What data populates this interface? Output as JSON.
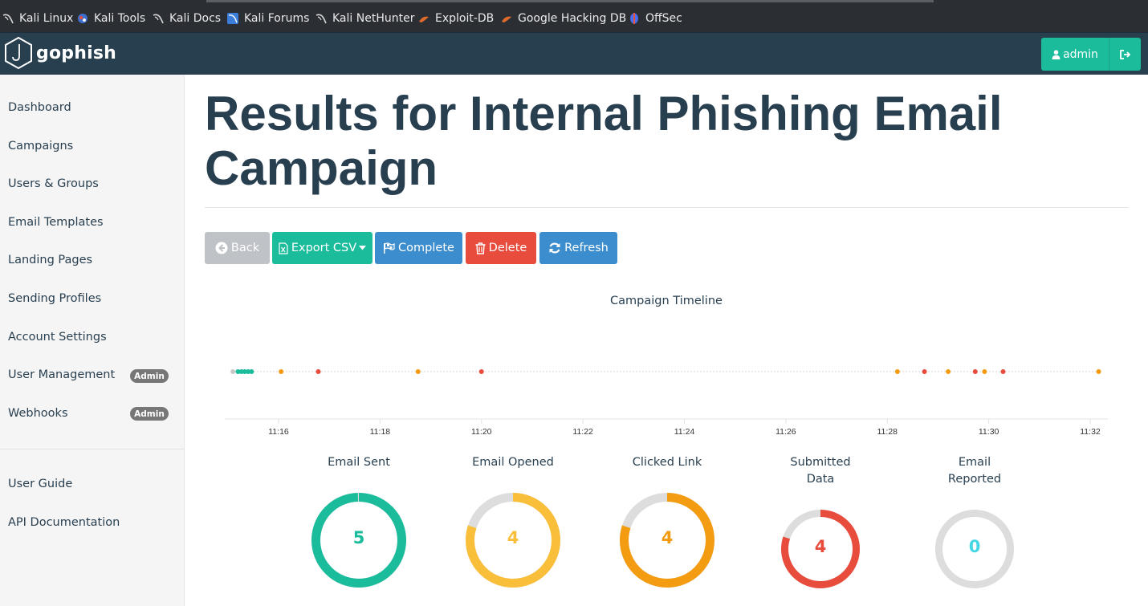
{
  "bookmarks": [
    {
      "label": "Kali Linux",
      "icon": "kali-dragon-icon"
    },
    {
      "label": "Kali Tools",
      "icon": "kali-tools-icon"
    },
    {
      "label": "Kali Docs",
      "icon": "kali-dragon-icon"
    },
    {
      "label": "Kali Forums",
      "icon": "kali-forums-icon"
    },
    {
      "label": "Kali NetHunter",
      "icon": "kali-dragon-icon"
    },
    {
      "label": "Exploit-DB",
      "icon": "exploit-db-icon"
    },
    {
      "label": "Google Hacking DB",
      "icon": "exploit-db-icon"
    },
    {
      "label": "OffSec",
      "icon": "offsec-icon"
    }
  ],
  "navbar": {
    "brand": "gophish",
    "user_label": "admin",
    "colors": {
      "bar": "#283f50",
      "accent": "#1abc9c"
    }
  },
  "sidebar": {
    "items": [
      {
        "label": "Dashboard"
      },
      {
        "label": "Campaigns"
      },
      {
        "label": "Users & Groups"
      },
      {
        "label": "Email Templates"
      },
      {
        "label": "Landing Pages"
      },
      {
        "label": "Sending Profiles"
      },
      {
        "label": "Account Settings"
      },
      {
        "label": "User Management",
        "badge": "Admin"
      },
      {
        "label": "Webhooks",
        "badge": "Admin"
      }
    ],
    "footer_items": [
      {
        "label": "User Guide"
      },
      {
        "label": "API Documentation"
      }
    ]
  },
  "page": {
    "title_line1": "Results for Internal Phishing Email",
    "title_line2": "Campaign"
  },
  "actions": {
    "back": "Back",
    "export": "Export CSV",
    "complete": "Complete",
    "delete": "Delete",
    "refresh": "Refresh"
  },
  "timeline": {
    "title": "Campaign Timeline",
    "ticks": [
      "11:16",
      "11:18",
      "11:20",
      "11:22",
      "11:24",
      "11:26",
      "11:28",
      "11:30",
      "11:32"
    ],
    "events": [
      {
        "t": "11:15:06",
        "type": "launched",
        "color": "#c8c8c8"
      },
      {
        "t": "11:15:12",
        "type": "sent",
        "color": "#1abc9c"
      },
      {
        "t": "11:15:16",
        "type": "sent",
        "color": "#1abc9c"
      },
      {
        "t": "11:15:20",
        "type": "sent",
        "color": "#1abc9c"
      },
      {
        "t": "11:15:24",
        "type": "sent",
        "color": "#1abc9c"
      },
      {
        "t": "11:15:28",
        "type": "sent",
        "color": "#1abc9c"
      },
      {
        "t": "11:16:03",
        "type": "opened",
        "color": "#f39c12"
      },
      {
        "t": "11:16:47",
        "type": "submitted",
        "color": "#e74c3c"
      },
      {
        "t": "11:18:45",
        "type": "clicked",
        "color": "#f39c12"
      },
      {
        "t": "11:20:00",
        "type": "submitted",
        "color": "#e74c3c"
      },
      {
        "t": "11:28:12",
        "type": "clicked",
        "color": "#f39c12"
      },
      {
        "t": "11:28:44",
        "type": "submitted",
        "color": "#e74c3c"
      },
      {
        "t": "11:29:12",
        "type": "clicked",
        "color": "#f39c12"
      },
      {
        "t": "11:29:44",
        "type": "submitted",
        "color": "#e74c3c"
      },
      {
        "t": "11:29:55",
        "type": "clicked",
        "color": "#f39c12"
      },
      {
        "t": "11:30:17",
        "type": "submitted",
        "color": "#e74c3c"
      },
      {
        "t": "11:32:10",
        "type": "clicked",
        "color": "#f39c12"
      }
    ]
  },
  "stats": [
    {
      "label": "Email Sent",
      "label2": "",
      "value": "5",
      "fraction": 1.0,
      "color": "#1abc9c"
    },
    {
      "label": "Email Opened",
      "label2": "",
      "value": "4",
      "fraction": 0.8,
      "color": "#f9bf3b"
    },
    {
      "label": "Clicked Link",
      "label2": "",
      "value": "4",
      "fraction": 0.8,
      "color": "#f39c12"
    },
    {
      "label": "Submitted",
      "label2": "Data",
      "value": "4",
      "fraction": 0.8,
      "color": "#e74c3c"
    },
    {
      "label": "Email",
      "label2": "Reported",
      "value": "0",
      "fraction": 0.0,
      "color": "#45d6e6"
    }
  ]
}
